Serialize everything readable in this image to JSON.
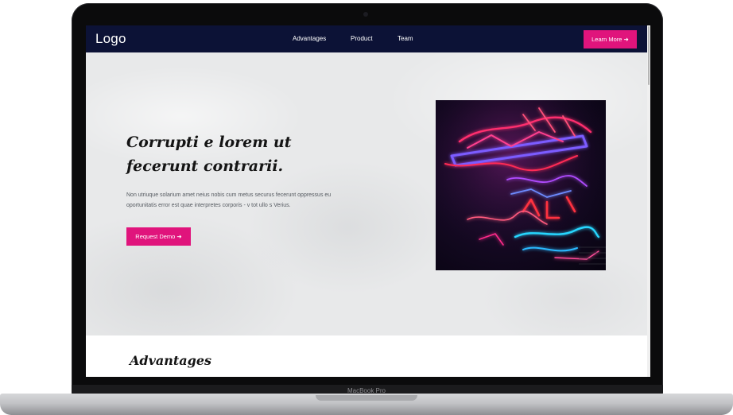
{
  "nav": {
    "logo": "Logo",
    "links": [
      "Advantages",
      "Product",
      "Team"
    ],
    "cta_label": "Learn More ➜"
  },
  "hero": {
    "title": "Corrupti e lorem ut fecerunt contrarii.",
    "text": "Non utriuque solarium amet neius nobis cum metus securus fecerunt oppressus eu oportunitatis error est quae interpretes corporis - v tot ullo s Verius.",
    "button_label": "Request Demo ➜"
  },
  "advantages": {
    "title": "Advantages"
  },
  "device": {
    "label": "MacBook Pro"
  },
  "colors": {
    "nav_bg": "#0c1236",
    "accent": "#e0147c"
  }
}
